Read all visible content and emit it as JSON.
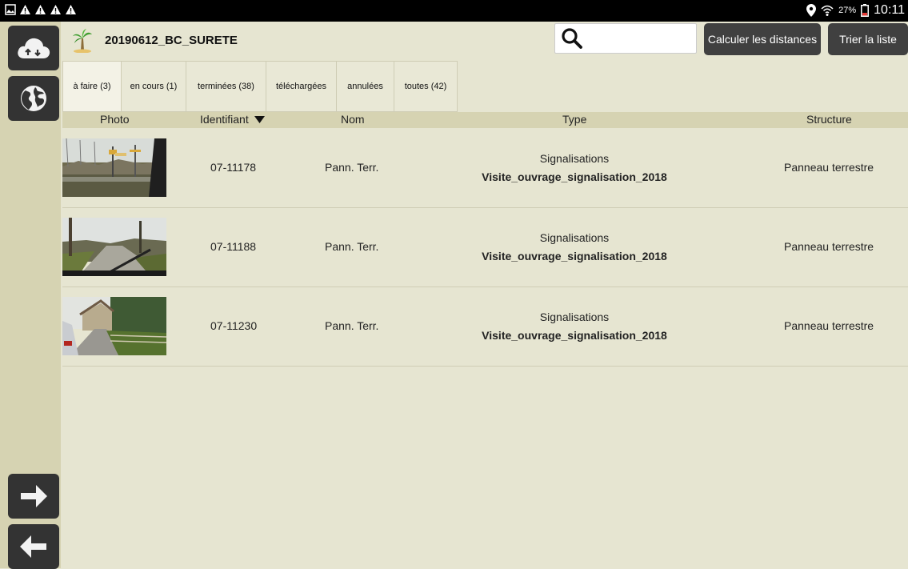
{
  "status_bar": {
    "left_icons": [
      "image-notification-icon",
      "warning-icon",
      "warning-icon",
      "warning-icon",
      "warning-icon"
    ],
    "battery": "27%",
    "time": "10:11"
  },
  "sidebar": {
    "buttons": [
      "cloud-sync-icon",
      "globe-icon",
      "arrow-right-icon",
      "arrow-left-icon"
    ]
  },
  "header": {
    "project_title": "20190612_BC_SURETE",
    "search_value": "",
    "calc_button": "Calculer les distances",
    "sort_button": "Trier la liste"
  },
  "tabs": [
    {
      "label": "à faire (3)",
      "active": true
    },
    {
      "label": "en cours (1)"
    },
    {
      "label": "terminées (38)"
    },
    {
      "label": "téléchargées"
    },
    {
      "label": "annulées"
    },
    {
      "label": "toutes (42)"
    }
  ],
  "table": {
    "columns": {
      "photo": "Photo",
      "identifiant": "Identifiant",
      "nom": "Nom",
      "type": "Type",
      "structure": "Structure"
    },
    "rows": [
      {
        "id": "07-11178",
        "nom": "Pann. Terr.",
        "type1": "Signalisations",
        "type2": "Visite_ouvrage_signalisation_2018",
        "structure": "Panneau terrestre"
      },
      {
        "id": "07-11188",
        "nom": "Pann. Terr.",
        "type1": "Signalisations",
        "type2": "Visite_ouvrage_signalisation_2018",
        "structure": "Panneau terrestre"
      },
      {
        "id": "07-11230",
        "nom": "Pann. Terr.",
        "type1": "Signalisations",
        "type2": "Visite_ouvrage_signalisation_2018",
        "structure": "Panneau terrestre"
      }
    ]
  },
  "colors": {
    "background": "#e6e5d1",
    "sidebar": "#d6d3b2",
    "button": "#404040"
  }
}
